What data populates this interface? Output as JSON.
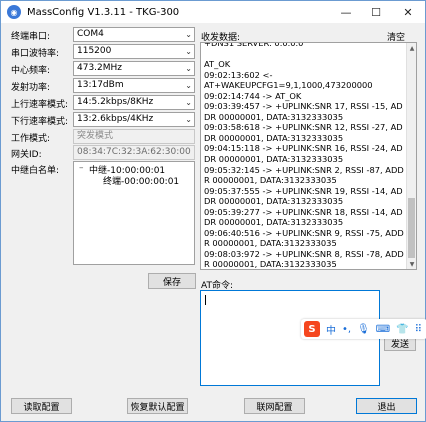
{
  "window": {
    "title": "MassConfig V1.3.11 - TKG-300",
    "min_glyph": "—",
    "max_glyph": "☐",
    "close_glyph": "✕"
  },
  "form": {
    "port_label": "终端串口:",
    "port_value": "COM4",
    "baud_label": "串口波特率:",
    "baud_value": "115200",
    "freq_label": "中心频率:",
    "freq_value": "473.2MHz",
    "power_label": "发射功率:",
    "power_value": "13:17dBm",
    "uplink_label": "上行速率模式:",
    "uplink_value": "14:5.2kbps/8KHz",
    "downlink_label": "下行速率模式:",
    "downlink_value": "13:2.6kbps/4KHz",
    "workmode_label": "工作模式:",
    "workmode_value": "突发模式",
    "gateway_label": "网关ID:",
    "gateway_value": "08:34:7C:32:3A:62:30:00",
    "whitelist_label": "中继白名单:",
    "whitelist_tree": {
      "relay": "中继-10:00:00:01",
      "terminal": "终端-00:00:00:01",
      "expander": "–"
    },
    "arrow_glyph": "⌄"
  },
  "buttons": {
    "save": "保存",
    "read_config": "读取配置",
    "restore_default": "恢复默认配置",
    "network_config": "联网配置",
    "exit": "退出",
    "send": "发送"
  },
  "recv": {
    "label": "收发数据:",
    "clear": "清空",
    "text": "+DNS1 SERVER: 0.0.0.0\n\nAT_OK\n09:02:13:602 <-\nAT+WAKEUPCFG1=9,1,1000,473200000\n09:02:14:744 -> AT_OK\n09:03:39:457 -> +UPLINK:SNR 17, RSSI -15, ADDR 00000001, DATA:3132333035\n09:03:58:618 -> +UPLINK:SNR 12, RSSI -27, ADDR 00000001, DATA:3132333035\n09:04:15:118 -> +UPLINK:SNR 16, RSSI -24, ADDR 00000001, DATA:3132333035\n09:05:32:145 -> +UPLINK:SNR 2, RSSI -87, ADDR 00000001, DATA:3132333035\n09:05:37:555 -> +UPLINK:SNR 19, RSSI -14, ADDR 00000001, DATA:3132333035\n09:05:39:277 -> +UPLINK:SNR 18, RSSI -14, ADDR 00000001, DATA:3132333035\n09:06:40:516 -> +UPLINK:SNR 9, RSSI -75, ADDR 00000001, DATA:3132333035\n09:08:03:972 -> +UPLINK:SNR 8, RSSI -78, ADDR 00000001, DATA:3132333035",
    "scroll_up": "▲",
    "scroll_down": "▼"
  },
  "at": {
    "label": "AT命令:",
    "value": ""
  },
  "ime": {
    "logo": "S",
    "lang": "中",
    "punct": "•,",
    "mic": "🎙",
    "keyboard": "⌨",
    "skin": "👕",
    "more": "⠿"
  }
}
